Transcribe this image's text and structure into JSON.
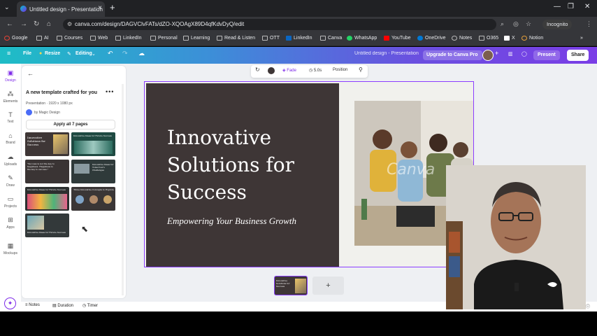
{
  "browser": {
    "tab_title": "Untitled design - Presentation",
    "url": "canva.com/design/DAGVClvFATs/dZO-XQOAgX89D4qfKdvDyQ/edit",
    "incognito_label": "Incognito",
    "bookmarks": [
      "Google",
      "AI",
      "Courses",
      "Web",
      "LinkedIn",
      "Personal",
      "Learning",
      "Read & Listen",
      "OTT",
      "LinkedIn",
      "Canva",
      "WhatsApp",
      "YouTube",
      "OneDrive",
      "Notes",
      "O365",
      "X",
      "Notion"
    ]
  },
  "canva_header": {
    "file_label": "File",
    "resize_label": "Resize",
    "editing_label": "Editing",
    "doc_title": "Untitled design - Presentation",
    "upgrade_label": "Upgrade to Canva Pro",
    "present_label": "Present",
    "share_label": "Share"
  },
  "rail": {
    "items": [
      "Design",
      "Elements",
      "Text",
      "Brand",
      "Uploads",
      "Draw",
      "Projects",
      "Apps",
      "Mockups"
    ]
  },
  "panel": {
    "title": "A new template crafted for you",
    "meta": "Presentation · 1920 x 1080 px",
    "by": "by Magic Design",
    "apply_label": "Apply all 7 pages",
    "thumbs": [
      {
        "text": "Innovative Solutions for Success"
      },
      {
        "text": "Innovative Ideas for Future Success"
      },
      {
        "text": "\"Success is not the key to happiness. Happiness is the key to success.\""
      },
      {
        "text": "Innovative Ideas for Tomorrow's Challenges"
      },
      {
        "text": "Innovative Ideas for Future Success"
      },
      {
        "text": "Three Innovative Concepts to Explore"
      },
      {
        "text": "Innovative Ideas for Future Success"
      }
    ]
  },
  "context_toolbar": {
    "fade_label": "Fade",
    "duration_label": "5.0s",
    "position_label": "Position"
  },
  "slide": {
    "headline": "Innovative Solutions for Success",
    "subheadline": "Empowering Your Business Growth",
    "watermark": "Canva"
  },
  "bottom": {
    "notes_label": "Notes",
    "duration_label": "Duration",
    "timer_label": "Timer",
    "add_page_symbol": "+"
  },
  "colors": {
    "accent": "#7d2ae8",
    "slide_dark": "#3e3636"
  }
}
